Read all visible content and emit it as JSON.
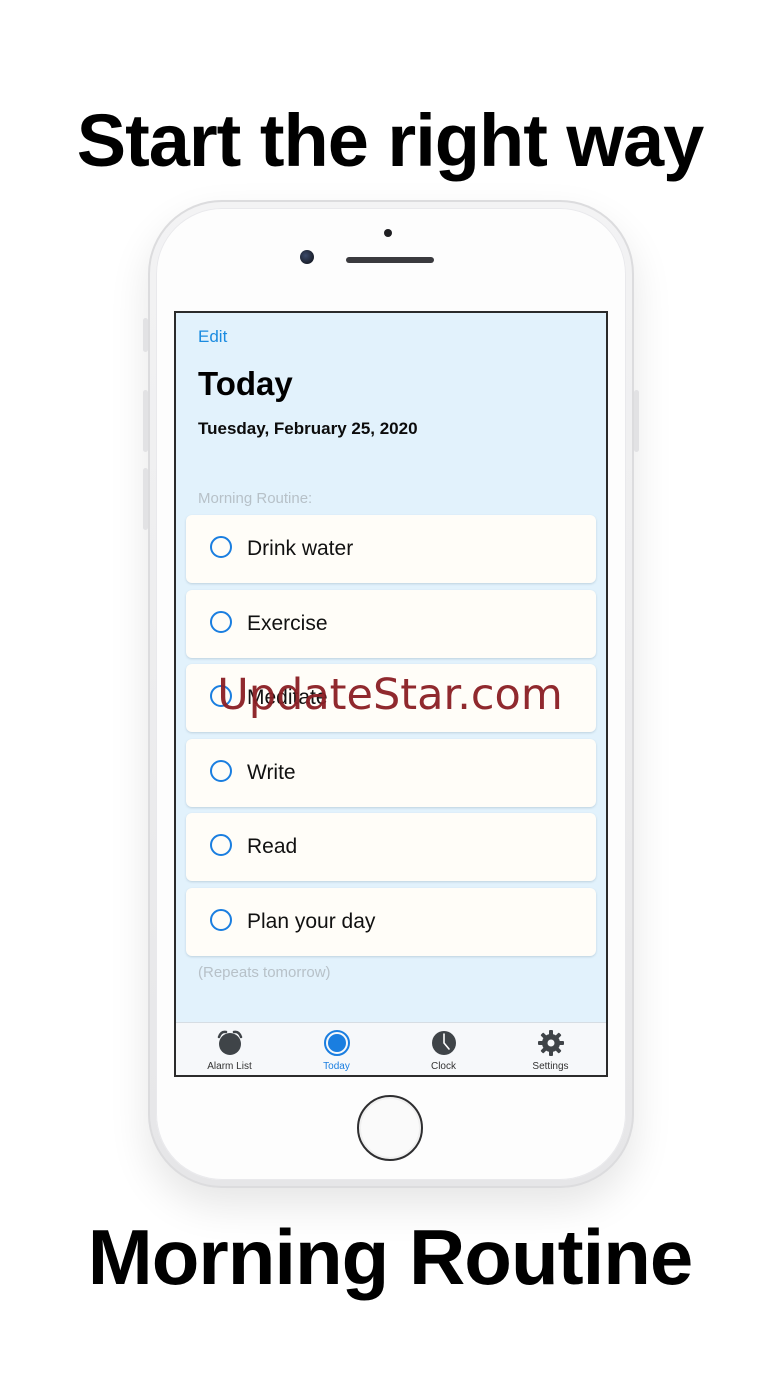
{
  "headline_top": "Start the right way",
  "headline_bottom": "Morning Routine",
  "screen": {
    "edit_label": "Edit",
    "title": "Today",
    "date": "Tuesday, February 25, 2020",
    "section_label": "Morning Routine:",
    "tasks": [
      {
        "label": "Drink water",
        "done": false
      },
      {
        "label": "Exercise",
        "done": false
      },
      {
        "label": "Meditate",
        "done": false
      },
      {
        "label": "Write",
        "done": false
      },
      {
        "label": "Read",
        "done": false
      },
      {
        "label": "Plan your day",
        "done": false
      }
    ],
    "repeat_note": "(Repeats tomorrow)"
  },
  "tabbar": {
    "items": [
      {
        "label": "Alarm List",
        "icon": "alarm-clock-icon",
        "active": false
      },
      {
        "label": "Today",
        "icon": "today-circle-icon",
        "active": true
      },
      {
        "label": "Clock",
        "icon": "clock-icon",
        "active": false
      },
      {
        "label": "Settings",
        "icon": "gear-icon",
        "active": false
      }
    ]
  },
  "watermark": "UpdateStar.com",
  "colors": {
    "accent": "#1a7ee0",
    "screen_background": "#e2f2fc",
    "row_background": "#fffdf8",
    "watermark": "#8b1e24"
  }
}
